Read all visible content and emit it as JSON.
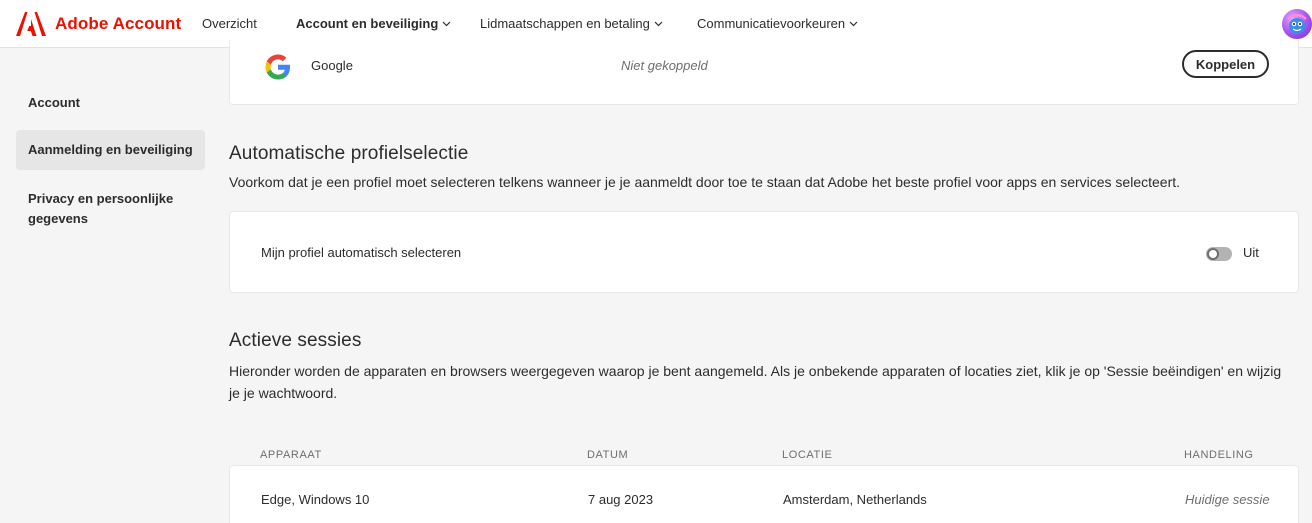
{
  "header": {
    "brand": "Adobe Account",
    "nav": [
      {
        "label": "Overzicht",
        "active": false,
        "dropdown": false
      },
      {
        "label": "Account en beveiliging",
        "active": true,
        "dropdown": true
      },
      {
        "label": "Lidmaatschappen en betaling",
        "active": false,
        "dropdown": true
      },
      {
        "label": "Communicatievoorkeuren",
        "active": false,
        "dropdown": true
      }
    ]
  },
  "sidebar": {
    "items": [
      {
        "label": "Account",
        "selected": false
      },
      {
        "label": "Aanmelding en beveiliging",
        "selected": true
      },
      {
        "label": "Privacy en persoonlijke gegevens",
        "selected": false
      }
    ]
  },
  "google": {
    "name": "Google",
    "status": "Niet gekoppeld",
    "button": "Koppelen"
  },
  "auto_profile": {
    "title": "Automatische profielselectie",
    "description": "Voorkom dat je een profiel moet selecteren telkens wanneer je je aanmeldt door toe te staan dat Adobe het beste profiel voor apps en services selecteert.",
    "setting_label": "Mijn profiel automatisch selecteren",
    "toggle_state": "Uit",
    "toggle_on": false
  },
  "sessions": {
    "title": "Actieve sessies",
    "description": "Hieronder worden de apparaten en browsers weergegeven waarop je bent aangemeld. Als je onbekende apparaten of locaties ziet, klik je op 'Sessie beëindigen' en wijzig je je wachtwoord.",
    "columns": [
      "APPARAAT",
      "DATUM",
      "LOCATIE",
      "HANDELING"
    ],
    "rows": [
      {
        "device": "Edge, Windows 10",
        "date": "7 aug 2023",
        "location": "Amsterdam, Netherlands",
        "action": "Huidige sessie"
      }
    ]
  },
  "colors": {
    "brand_red": "#eb1000",
    "page_bg": "#f5f5f5",
    "text": "#2c2c2c",
    "muted": "#6e6e6e"
  }
}
